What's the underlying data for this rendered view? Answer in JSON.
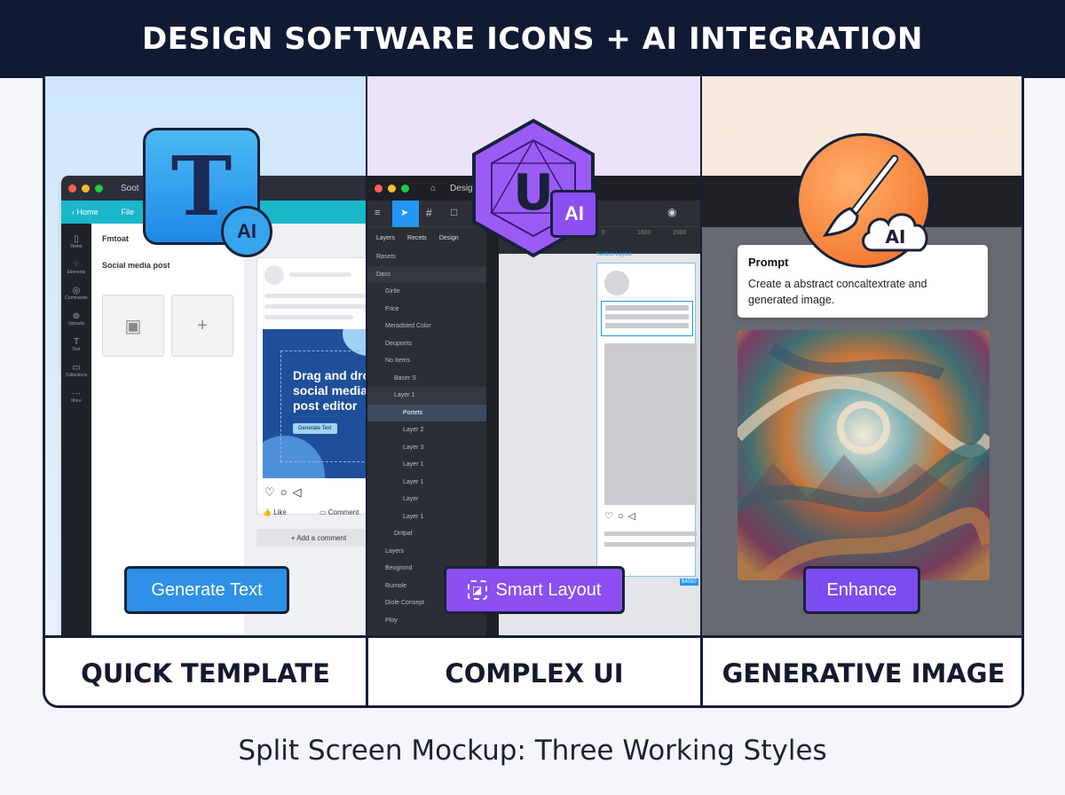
{
  "header": {
    "title": "DESIGN SOFTWARE ICONS + AI INTEGRATION"
  },
  "panels": [
    {
      "label": "QUICK TEMPLATE",
      "badge": "AI",
      "button": "Generate Text",
      "accent": "#2e90e6",
      "window": {
        "tab": "Soot",
        "nav": [
          "Home",
          "File"
        ],
        "rail": [
          "Home",
          "Elements",
          "Commands",
          "Uploads",
          "Text",
          "Collections",
          "More"
        ],
        "section_title": "Fmtoat",
        "template_title": "Social media post",
        "banner_text": "Drag and drop social media post editor",
        "banner_button": "Generate Text",
        "actions": [
          "Like",
          "Comment"
        ],
        "add_comment": "+ Add a comment"
      }
    },
    {
      "label": "COMPLEX UI",
      "badge": "AI",
      "button": "Smart Layout",
      "accent": "#8b4ff2",
      "window": {
        "tab": "Desig",
        "panel_tabs": [
          "Layers",
          "Recets",
          "Design"
        ],
        "ruler": [
          "0",
          "1600",
          "2000"
        ],
        "frame_label": "Section Layout",
        "size_badge": "$4050",
        "layers": [
          "Rasets",
          "Dass",
          "Girtle",
          "Frice",
          "Meradsted Color",
          "Deuponts",
          "No Items",
          "Bacer S",
          "Layer 1",
          "Portets",
          "Layer 2",
          "Layer 3",
          "Layer 1",
          "Layer 1",
          "Layer",
          "Layer 1",
          "Dntpaf",
          "Layers",
          "Beogrond",
          "Rumole",
          "Diole Consept",
          "Ploy"
        ]
      }
    },
    {
      "label": "GENERATIVE IMAGE",
      "badge": "AI",
      "button": "Enhance",
      "accent": "#7c4cf0",
      "window": {
        "prompt_title": "Prompt",
        "prompt_text": "Create a abstract concaltextrate and generated image."
      }
    }
  ],
  "caption": "Split Screen Mockup: Three Working Styles"
}
